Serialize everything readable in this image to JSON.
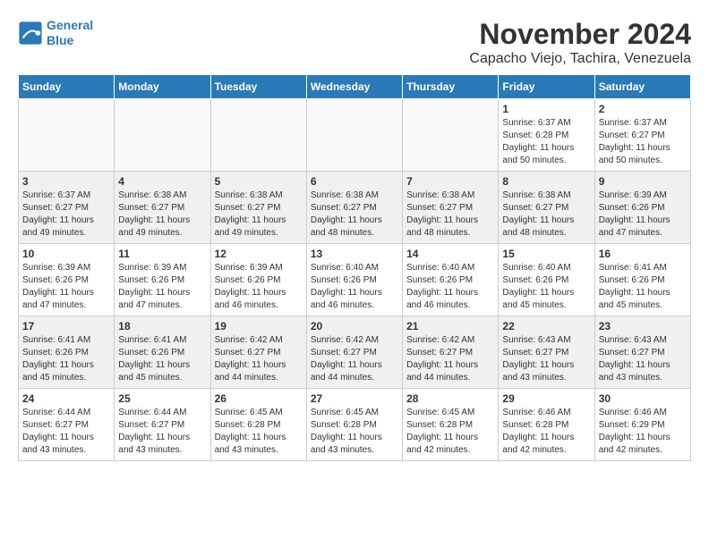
{
  "header": {
    "logo_line1": "General",
    "logo_line2": "Blue",
    "month": "November 2024",
    "location": "Capacho Viejo, Tachira, Venezuela"
  },
  "days_of_week": [
    "Sunday",
    "Monday",
    "Tuesday",
    "Wednesday",
    "Thursday",
    "Friday",
    "Saturday"
  ],
  "weeks": [
    [
      {
        "day": "",
        "info": "",
        "empty": true
      },
      {
        "day": "",
        "info": "",
        "empty": true
      },
      {
        "day": "",
        "info": "",
        "empty": true
      },
      {
        "day": "",
        "info": "",
        "empty": true
      },
      {
        "day": "",
        "info": "",
        "empty": true
      },
      {
        "day": "1",
        "info": "Sunrise: 6:37 AM\nSunset: 6:28 PM\nDaylight: 11 hours and 50 minutes."
      },
      {
        "day": "2",
        "info": "Sunrise: 6:37 AM\nSunset: 6:27 PM\nDaylight: 11 hours and 50 minutes."
      }
    ],
    [
      {
        "day": "3",
        "info": "Sunrise: 6:37 AM\nSunset: 6:27 PM\nDaylight: 11 hours and 49 minutes."
      },
      {
        "day": "4",
        "info": "Sunrise: 6:38 AM\nSunset: 6:27 PM\nDaylight: 11 hours and 49 minutes."
      },
      {
        "day": "5",
        "info": "Sunrise: 6:38 AM\nSunset: 6:27 PM\nDaylight: 11 hours and 49 minutes."
      },
      {
        "day": "6",
        "info": "Sunrise: 6:38 AM\nSunset: 6:27 PM\nDaylight: 11 hours and 48 minutes."
      },
      {
        "day": "7",
        "info": "Sunrise: 6:38 AM\nSunset: 6:27 PM\nDaylight: 11 hours and 48 minutes."
      },
      {
        "day": "8",
        "info": "Sunrise: 6:38 AM\nSunset: 6:27 PM\nDaylight: 11 hours and 48 minutes."
      },
      {
        "day": "9",
        "info": "Sunrise: 6:39 AM\nSunset: 6:26 PM\nDaylight: 11 hours and 47 minutes."
      }
    ],
    [
      {
        "day": "10",
        "info": "Sunrise: 6:39 AM\nSunset: 6:26 PM\nDaylight: 11 hours and 47 minutes."
      },
      {
        "day": "11",
        "info": "Sunrise: 6:39 AM\nSunset: 6:26 PM\nDaylight: 11 hours and 47 minutes."
      },
      {
        "day": "12",
        "info": "Sunrise: 6:39 AM\nSunset: 6:26 PM\nDaylight: 11 hours and 46 minutes."
      },
      {
        "day": "13",
        "info": "Sunrise: 6:40 AM\nSunset: 6:26 PM\nDaylight: 11 hours and 46 minutes."
      },
      {
        "day": "14",
        "info": "Sunrise: 6:40 AM\nSunset: 6:26 PM\nDaylight: 11 hours and 46 minutes."
      },
      {
        "day": "15",
        "info": "Sunrise: 6:40 AM\nSunset: 6:26 PM\nDaylight: 11 hours and 45 minutes."
      },
      {
        "day": "16",
        "info": "Sunrise: 6:41 AM\nSunset: 6:26 PM\nDaylight: 11 hours and 45 minutes."
      }
    ],
    [
      {
        "day": "17",
        "info": "Sunrise: 6:41 AM\nSunset: 6:26 PM\nDaylight: 11 hours and 45 minutes."
      },
      {
        "day": "18",
        "info": "Sunrise: 6:41 AM\nSunset: 6:26 PM\nDaylight: 11 hours and 45 minutes."
      },
      {
        "day": "19",
        "info": "Sunrise: 6:42 AM\nSunset: 6:27 PM\nDaylight: 11 hours and 44 minutes."
      },
      {
        "day": "20",
        "info": "Sunrise: 6:42 AM\nSunset: 6:27 PM\nDaylight: 11 hours and 44 minutes."
      },
      {
        "day": "21",
        "info": "Sunrise: 6:42 AM\nSunset: 6:27 PM\nDaylight: 11 hours and 44 minutes."
      },
      {
        "day": "22",
        "info": "Sunrise: 6:43 AM\nSunset: 6:27 PM\nDaylight: 11 hours and 43 minutes."
      },
      {
        "day": "23",
        "info": "Sunrise: 6:43 AM\nSunset: 6:27 PM\nDaylight: 11 hours and 43 minutes."
      }
    ],
    [
      {
        "day": "24",
        "info": "Sunrise: 6:44 AM\nSunset: 6:27 PM\nDaylight: 11 hours and 43 minutes."
      },
      {
        "day": "25",
        "info": "Sunrise: 6:44 AM\nSunset: 6:27 PM\nDaylight: 11 hours and 43 minutes."
      },
      {
        "day": "26",
        "info": "Sunrise: 6:45 AM\nSunset: 6:28 PM\nDaylight: 11 hours and 43 minutes."
      },
      {
        "day": "27",
        "info": "Sunrise: 6:45 AM\nSunset: 6:28 PM\nDaylight: 11 hours and 43 minutes."
      },
      {
        "day": "28",
        "info": "Sunrise: 6:45 AM\nSunset: 6:28 PM\nDaylight: 11 hours and 42 minutes."
      },
      {
        "day": "29",
        "info": "Sunrise: 6:46 AM\nSunset: 6:28 PM\nDaylight: 11 hours and 42 minutes."
      },
      {
        "day": "30",
        "info": "Sunrise: 6:46 AM\nSunset: 6:29 PM\nDaylight: 11 hours and 42 minutes."
      }
    ]
  ]
}
